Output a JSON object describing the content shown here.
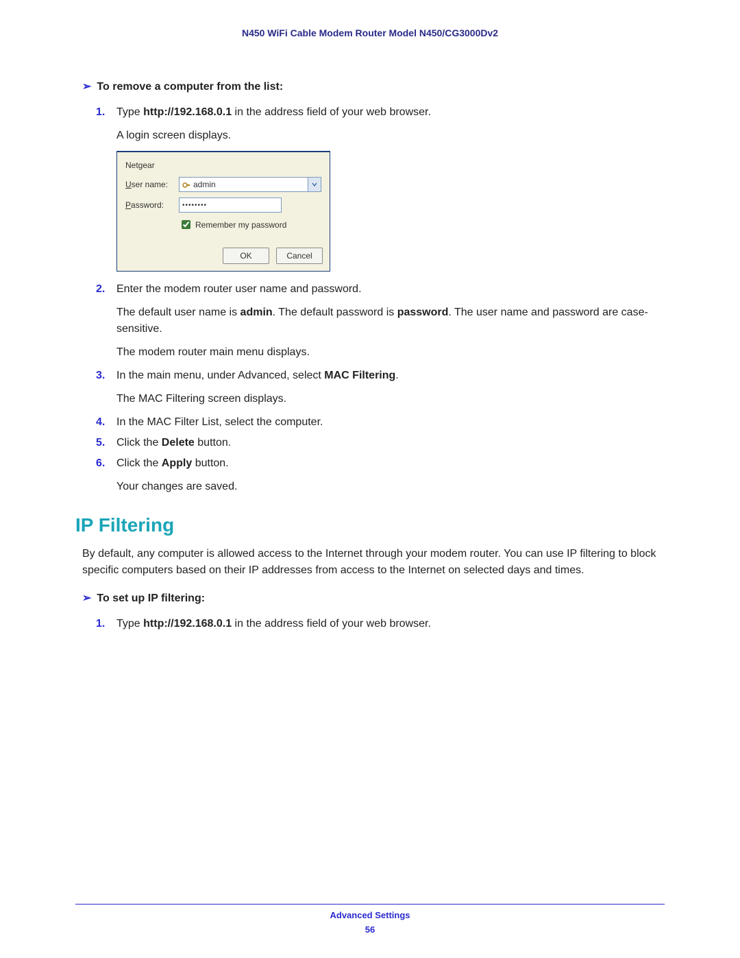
{
  "header": {
    "title": "N450 WiFi Cable Modem Router Model N450/CG3000Dv2"
  },
  "proc1": {
    "heading": "To remove a computer from the list:",
    "steps": {
      "s1_a": "Type ",
      "s1_b": "http://192.168.0.1",
      "s1_c": " in the address field of your web browser.",
      "s1_extra": "A login screen displays.",
      "s2_a": "Enter the modem router user name and password.",
      "s2_p1_a": "The default user name is ",
      "s2_p1_b": "admin",
      "s2_p1_c": ". The default password is ",
      "s2_p1_d": "password",
      "s2_p1_e": ". The user name and password are case-sensitive.",
      "s2_p2": "The modem router main menu displays.",
      "s3_a": "In the main menu, under Advanced, select ",
      "s3_b": "MAC Filtering",
      "s3_c": ".",
      "s3_extra": "The MAC Filtering screen displays.",
      "s4": "In the MAC Filter List, select the computer.",
      "s5_a": "Click the ",
      "s5_b": "Delete",
      "s5_c": " button.",
      "s6_a": "Click the ",
      "s6_b": "Apply",
      "s6_c": " button.",
      "s6_extra": "Your changes are saved."
    },
    "numbers": {
      "n1": "1.",
      "n2": "2.",
      "n3": "3.",
      "n4": "4.",
      "n5": "5.",
      "n6": "6."
    }
  },
  "login": {
    "realm": "Netgear",
    "username_label_u": "U",
    "username_label_rest": "ser name:",
    "password_label_u": "P",
    "password_label_rest": "assword:",
    "username_value": "admin",
    "password_masked": "••••••••",
    "remember_u": "R",
    "remember_rest": "emember my password",
    "ok": "OK",
    "cancel": "Cancel"
  },
  "section": {
    "title": "IP Filtering"
  },
  "section_para": "By default, any computer is allowed access to the Internet through your modem router. You can use IP filtering to block specific computers based on their IP addresses from access to the Internet on selected days and times.",
  "proc2": {
    "heading": "To set up IP filtering:",
    "s1_a": "Type ",
    "s1_b": "http://192.168.0.1",
    "s1_c": " in the address field of your web browser.",
    "n1": "1."
  },
  "footer": {
    "section": "Advanced Settings",
    "page": "56"
  },
  "glyphs": {
    "triangle": "➢"
  }
}
